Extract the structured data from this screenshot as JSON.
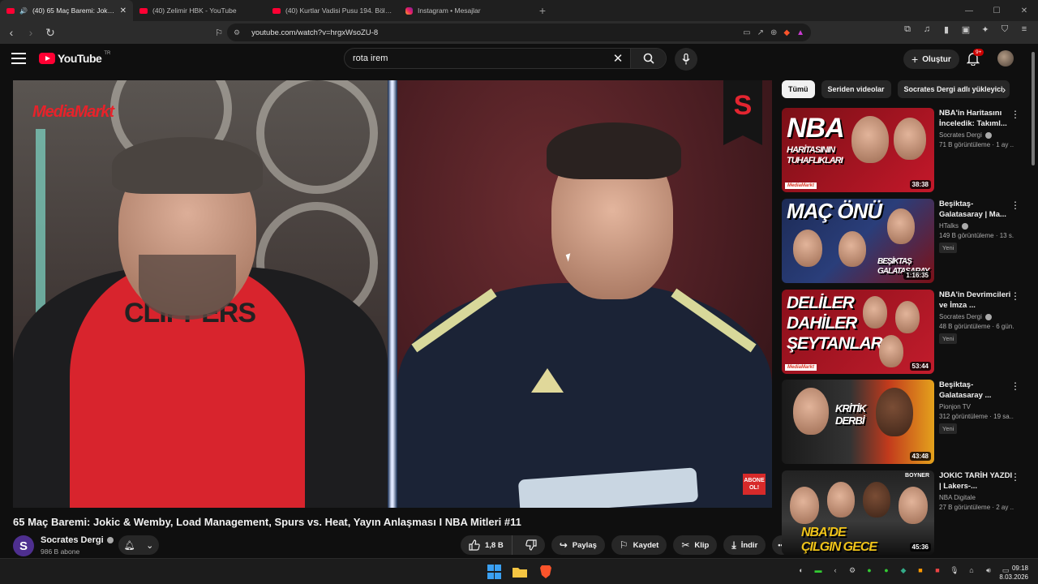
{
  "browser": {
    "tabs": [
      {
        "title": "(40) 65 Maç Baremi: Jokic & W",
        "active": true,
        "type": "youtube"
      },
      {
        "title": "(40) Zelimir HBK - YouTube",
        "active": false,
        "type": "youtube"
      },
      {
        "title": "(40) Kurtlar Vadisi Pusu 194. Bölüm -",
        "active": false,
        "type": "youtube"
      },
      {
        "title": "Instagram • Mesajlar",
        "active": false,
        "type": "instagram"
      }
    ],
    "url": "youtube.com/watch?v=hrgxWsoZU-8"
  },
  "youtube": {
    "logo_text": "YouTube",
    "country_code": "TR",
    "search_query": "rota irem",
    "create_label": "Oluştur",
    "notification_count": "9+"
  },
  "video": {
    "title": "65 Maç Baremi: Jokic & Wemby, Load Management, Spurs vs. Heat, Yayın Anlaşması I NBA Mitleri #11",
    "sponsor_text": "MediaMarkt",
    "overlay_logo": "S",
    "subscribe_badge": "ABONE OL!",
    "channel_initial": "S",
    "channel_name": "Socrates Dergi",
    "subscribers": "986 B abone",
    "likes": "1,8 B",
    "share_label": "Paylaş",
    "save_label": "Kaydet",
    "clip_label": "Klip",
    "download_label": "İndir"
  },
  "chips": [
    "Tümü",
    "Seriden videolar",
    "Socrates Dergi adlı yükleyici"
  ],
  "recommendations": [
    {
      "title": "NBA'in Haritasını İnceledik: Takıml...",
      "channel": "Socrates Dergi",
      "verified": true,
      "meta": "71 B görüntüleme · 1 ay ...",
      "badge": "",
      "duration": "38:38",
      "thumb_text": "NBA HARİTASININ TUHAFLIKLARI"
    },
    {
      "title": "Beşiktaş-Galatasaray | Ma...",
      "channel": "HTalks",
      "verified": true,
      "meta": "149 B görüntüleme · 13 s...",
      "badge": "Yeni",
      "duration": "1:16:35",
      "thumb_text": "MAÇ ÖNÜ BEŞİKTAŞ GALATASARAY"
    },
    {
      "title": "NBA'in Devrimcileri ve İmza ...",
      "channel": "Socrates Dergi",
      "verified": true,
      "meta": "48 B görüntüleme · 6 gün...",
      "badge": "Yeni",
      "duration": "53:44",
      "thumb_text": "DELİLER DAHİLER ŞEYTANLAR"
    },
    {
      "title": "Beşiktaş-Galatasaray ...",
      "channel": "Pionjon TV",
      "verified": false,
      "meta": "312 görüntüleme · 19 sa...",
      "badge": "Yeni",
      "duration": "43:48",
      "thumb_text": "KRİTİK DERBİ"
    },
    {
      "title": "JOKIC TARİH YAZDI | Lakers-...",
      "channel": "NBA Digitale",
      "verified": false,
      "meta": "27 B görüntüleme · 2 ay ...",
      "badge": "",
      "duration": "45:36",
      "thumb_text": "NBA'DE ÇILGIN GECE",
      "thumb_brand": "BOYNER"
    }
  ],
  "taskbar": {
    "time": "09:18",
    "date": "8.03.2026"
  },
  "colors": {
    "brand_red": "#ff0033",
    "background": "#0f0f0f",
    "pill": "#272727"
  }
}
